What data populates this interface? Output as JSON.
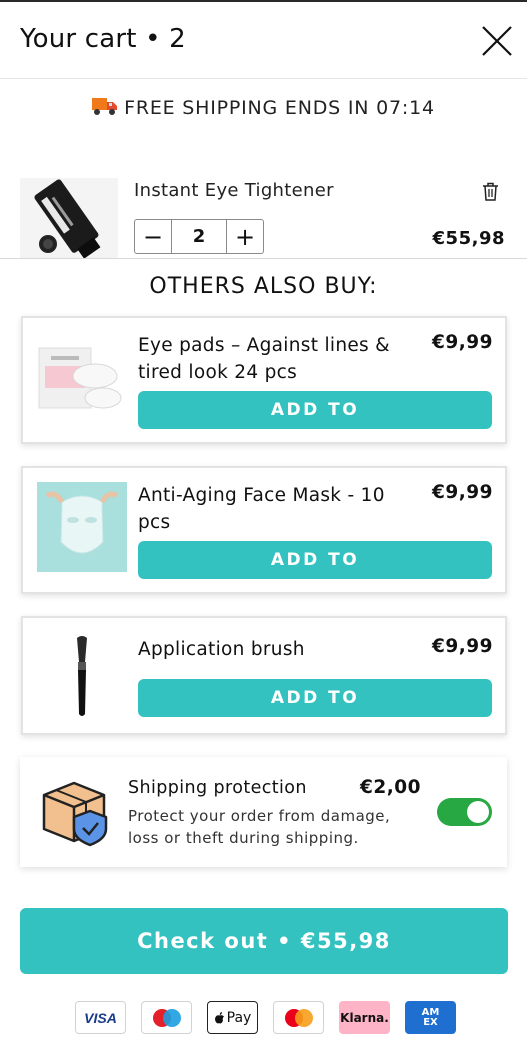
{
  "header": {
    "title": "Your cart • 2"
  },
  "banner": {
    "text": "FREE SHIPPING ENDS IN 07:14",
    "icon": "truck-icon"
  },
  "cart": {
    "items": [
      {
        "name": "Instant Eye Tightener",
        "quantity": "2",
        "price": "€55,98"
      }
    ],
    "minus_label": "−",
    "plus_label": "+"
  },
  "upsell": {
    "title": "OTHERS ALSO BUY:",
    "items": [
      {
        "name": "Eye pads – Against lines & tired look 24 pcs",
        "price": "€9,99",
        "button_label": "ADD TO"
      },
      {
        "name": "Anti-Aging Face Mask - 10 pcs",
        "price": "€9,99",
        "button_label": "ADD TO"
      },
      {
        "name": "Application brush",
        "price": "€9,99",
        "button_label": "ADD TO"
      }
    ]
  },
  "protection": {
    "title": "Shipping protection",
    "price": "€2,00",
    "description": "Protect your order from damage, loss or theft during shipping.",
    "enabled": true
  },
  "checkout": {
    "label": "Check out • €55,98"
  },
  "payments": {
    "visa": "VISA",
    "maestro": "Maestro",
    "applepay": "Pay",
    "mastercard": "Mastercard",
    "klarna": "Klarna.",
    "amex": "AM EX"
  },
  "colors": {
    "accent": "#34c2c0",
    "toggle_on": "#27a842",
    "text": "#111111"
  }
}
